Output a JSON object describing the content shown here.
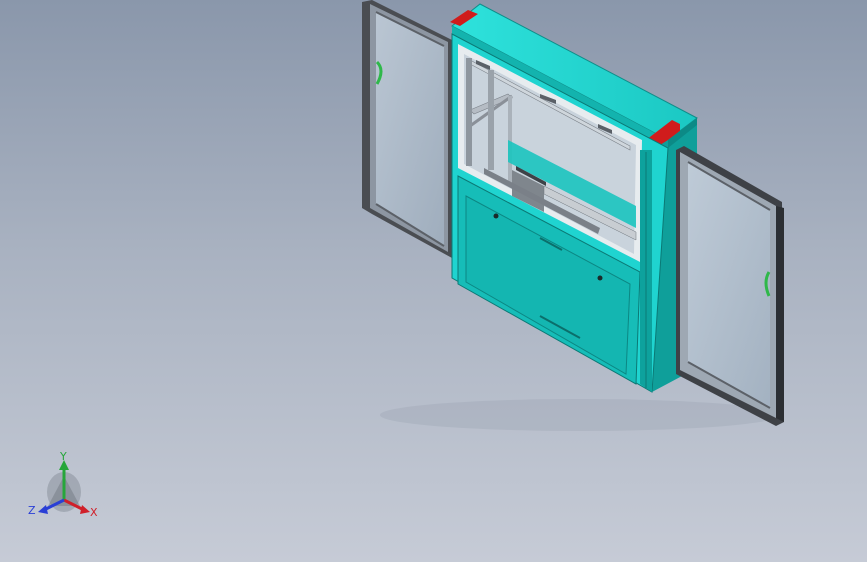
{
  "viewport": {
    "background_top": "#8a97ab",
    "background_bottom": "#c6cbd6"
  },
  "model": {
    "body_color": "#1fd4d0",
    "body_dark": "#0f9f9a",
    "frame_color": "#3c3f44",
    "glass_color": "#b8c8d8",
    "accent_red": "#d01c1c",
    "handle_green": "#2fb84a"
  },
  "triad": {
    "x_label": "X",
    "y_label": "Y",
    "z_label": "Z",
    "x_color": "#d0202a",
    "y_color": "#26a63a",
    "z_color": "#2a3fd6"
  }
}
